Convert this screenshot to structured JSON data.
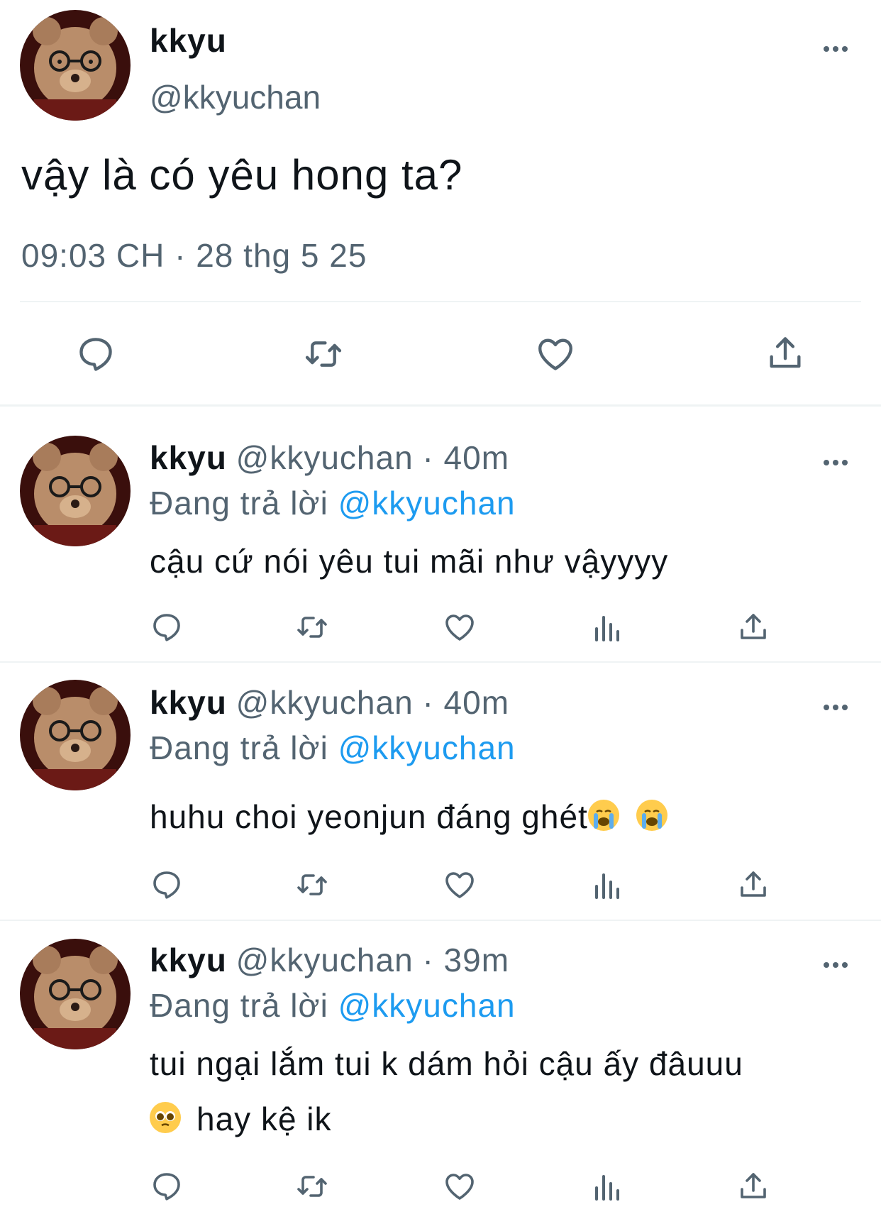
{
  "main_tweet": {
    "display_name": "kkyu",
    "handle": "@kkyuchan",
    "text": "vậy là có yêu hong ta?",
    "timestamp": "09:03 CH · 28 thg 5 25"
  },
  "replies": [
    {
      "display_name": "kkyu",
      "handle": "@kkyuchan",
      "time": "· 40m",
      "replying_prefix": "Đang trả lời",
      "replying_to": "@kkyuchan",
      "text": "cậu cứ nói yêu tui mãi như vậyyyy"
    },
    {
      "display_name": "kkyu",
      "handle": "@kkyuchan",
      "time": "· 40m",
      "replying_prefix": "Đang trả lời",
      "replying_to": "@kkyuchan",
      "text": "huhu choi yeonjun đáng ghét",
      "emojis": [
        "loudly-crying-face",
        "loudly-crying-face"
      ]
    },
    {
      "display_name": "kkyu",
      "handle": "@kkyuchan",
      "time": "· 39m",
      "replying_prefix": "Đang trả lời",
      "replying_to": "@kkyuchan",
      "text_line1": "tui ngại lắm tui k dám hỏi cậu ấy đâuuu",
      "text_line2": "hay kệ ik",
      "emojis": [
        "pleading-face"
      ]
    }
  ],
  "icons": {
    "reply": "reply-icon",
    "retweet": "retweet-icon",
    "like": "like-icon",
    "views": "views-icon",
    "share": "share-icon",
    "more": "more-icon"
  },
  "colors": {
    "text": "#0f1419",
    "secondary": "#536471",
    "link": "#1d9bf0",
    "divider": "#eff3f4"
  }
}
